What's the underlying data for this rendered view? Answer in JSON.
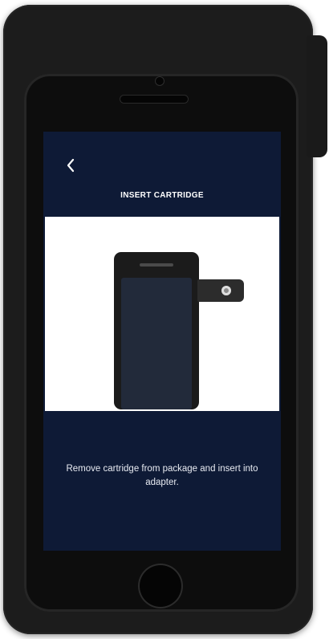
{
  "screen": {
    "title": "INSERT CARTRIDGE",
    "instruction": "Remove cartridge from package and insert into adapter."
  },
  "icons": {
    "back": "chevron-left-icon",
    "home": "home-button-icon"
  },
  "colors": {
    "screen_background": "#0e1a36",
    "adapter_case": "#1c1c1c",
    "text": "#ffffff"
  }
}
